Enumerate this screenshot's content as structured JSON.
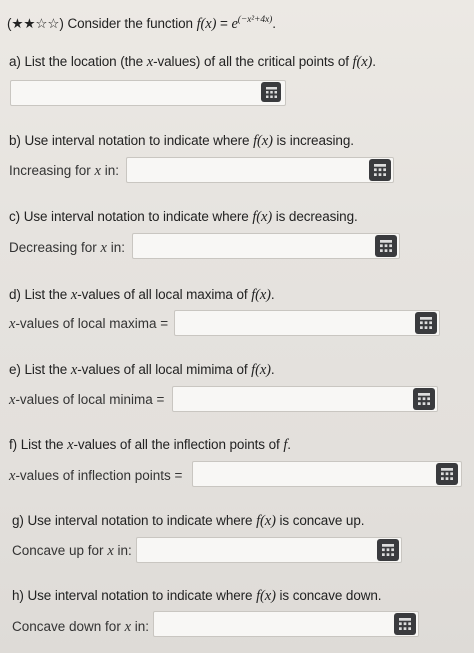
{
  "header": {
    "difficulty": "(★★☆☆)",
    "intro": "Consider the function",
    "fx": "f(x)",
    "equals": "=",
    "base": "e",
    "exponent": "(−x²+4x)",
    "period": "."
  },
  "questions": [
    {
      "letter": "a)",
      "prompt": "List the location (the ",
      "var": "x",
      "prompt2": "-values) of all the critical points of ",
      "fx": "f(x)",
      "end": ".",
      "label": "",
      "icon": "keypad-icon"
    },
    {
      "letter": "b)",
      "prompt": "Use interval notation to indicate where ",
      "fx": "f(x)",
      "prompt2": " is increasing.",
      "label": "Increasing for ",
      "labelVar": "x",
      "labelEnd": " in:",
      "icon": "keypad-icon"
    },
    {
      "letter": "c)",
      "prompt": "Use interval notation to indicate where ",
      "fx": "f(x)",
      "prompt2": " is decreasing.",
      "label": "Decreasing for ",
      "labelVar": "x",
      "labelEnd": " in:",
      "icon": "keypad-icon"
    },
    {
      "letter": "d)",
      "prompt": "List the ",
      "var": "x",
      "prompt2": "-values of all local maxima of ",
      "fx": "f(x)",
      "end": ".",
      "labelVar": "x",
      "label": "-values of local maxima =",
      "icon": "keypad-icon"
    },
    {
      "letter": "e)",
      "prompt": "List the ",
      "var": "x",
      "prompt2": "-values of all local mimima of ",
      "fx": "f(x)",
      "end": ".",
      "labelVar": "x",
      "label": "-values of local minima =",
      "icon": "keypad-icon"
    },
    {
      "letter": "f)",
      "prompt": "List the ",
      "var": "x",
      "prompt2": "-values of all the inflection points of ",
      "fx": "f",
      "end": ".",
      "labelVar": "x",
      "label": "-values of inflection points =",
      "icon": "keypad-icon"
    },
    {
      "letter": "g)",
      "prompt": "Use interval notation to indicate where ",
      "fx": "f(x)",
      "prompt2": " is concave up.",
      "label": "Concave up for ",
      "labelVar": "x",
      "labelEnd": " in:",
      "icon": "keypad-icon"
    },
    {
      "letter": "h)",
      "prompt": "Use interval notation to indicate where ",
      "fx": "f(x)",
      "prompt2": " is concave down.",
      "label": "Concave down for ",
      "labelVar": "x",
      "labelEnd": " in:",
      "icon": "keypad-icon"
    }
  ],
  "answers": [
    "",
    "",
    "",
    "",
    "",
    "",
    "",
    ""
  ]
}
